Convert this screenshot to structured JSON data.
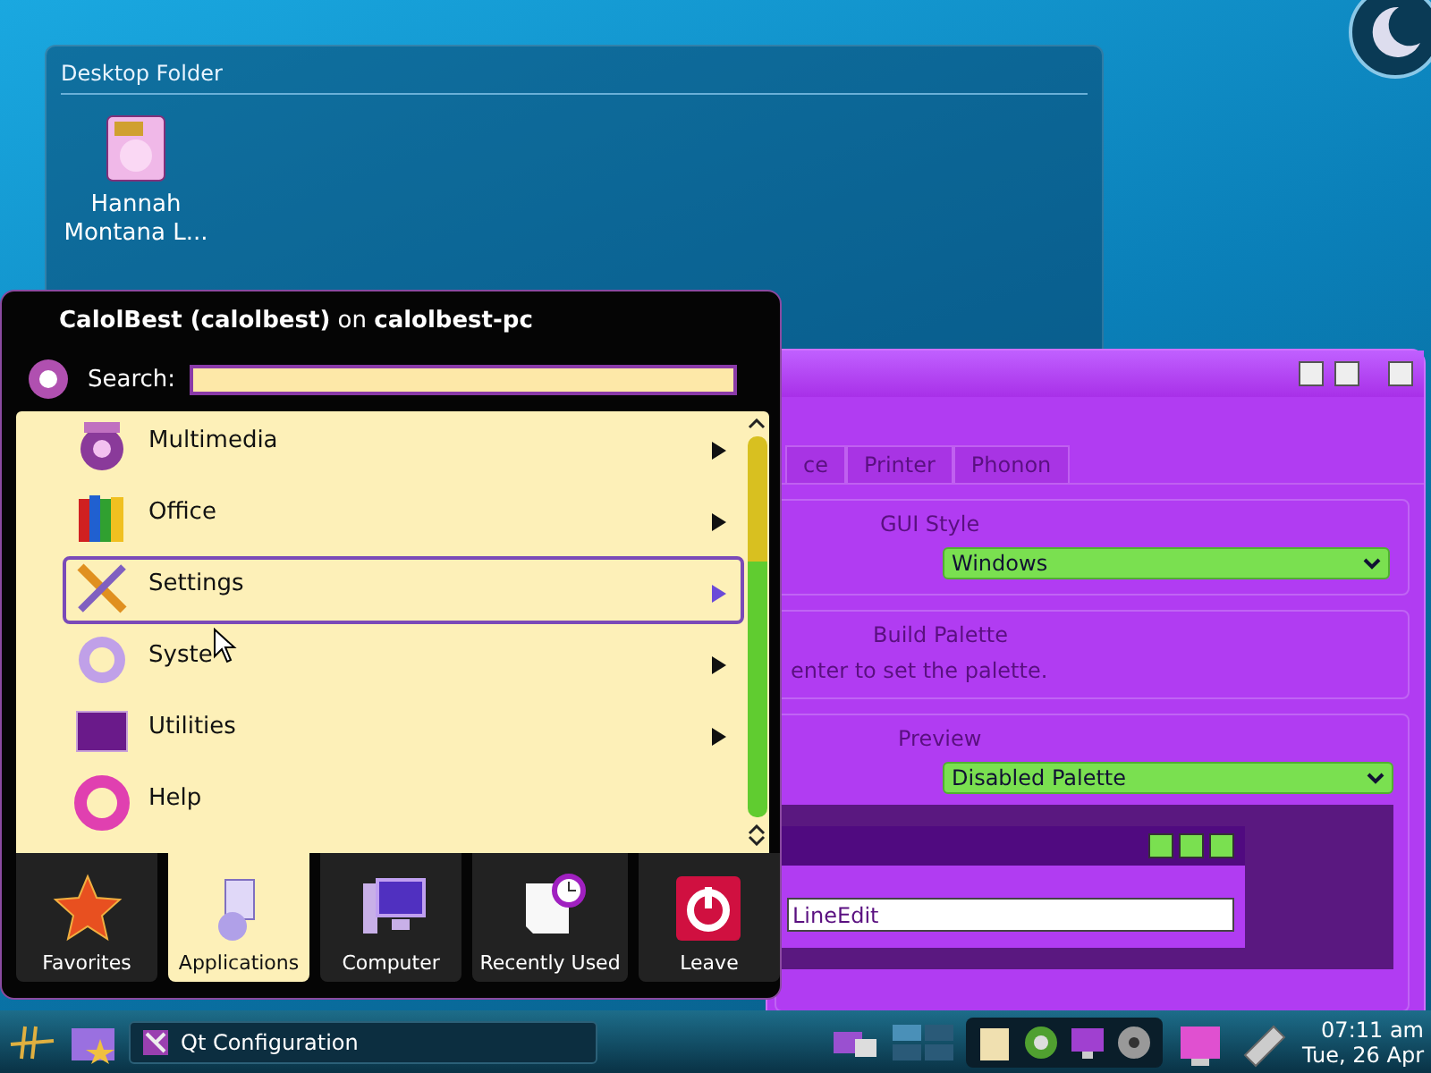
{
  "desktop_folder": {
    "title": "Desktop Folder",
    "icons": [
      {
        "label": "Hannah Montana L..."
      }
    ]
  },
  "qt_window": {
    "tabs": [
      {
        "label": "ce",
        "selected": false
      },
      {
        "label": "Printer",
        "selected": false
      },
      {
        "label": "Phonon",
        "selected": false
      }
    ],
    "gui_style": {
      "title": "GUI Style",
      "value": "Windows"
    },
    "build_palette": {
      "title": "Build Palette",
      "text": "enter to set the palette."
    },
    "preview": {
      "title": "Preview",
      "value": "Disabled Palette",
      "line_edit": "LineEdit"
    }
  },
  "launcher": {
    "header": "**CalolBest (calolbest)** on **calolbest-pc**",
    "search_label": "Search:",
    "items": [
      {
        "label": "Multimedia",
        "selected": false
      },
      {
        "label": "Office",
        "selected": false
      },
      {
        "label": "Settings",
        "selected": true
      },
      {
        "label": "Syste",
        "selected": false
      },
      {
        "label": "Utilities",
        "selected": false
      },
      {
        "label": "Help",
        "selected": false
      }
    ],
    "tabs": [
      {
        "label": "Favorites",
        "selected": false
      },
      {
        "label": "Applications",
        "selected": true
      },
      {
        "label": "Computer",
        "selected": false
      },
      {
        "label": "Recently Used",
        "selected": false
      },
      {
        "label": "Leave",
        "selected": false
      }
    ]
  },
  "taskbar": {
    "tasks": [
      {
        "label": "Qt Configuration"
      }
    ],
    "time": "07:11 am",
    "date": "Tue, 26 Apr"
  }
}
